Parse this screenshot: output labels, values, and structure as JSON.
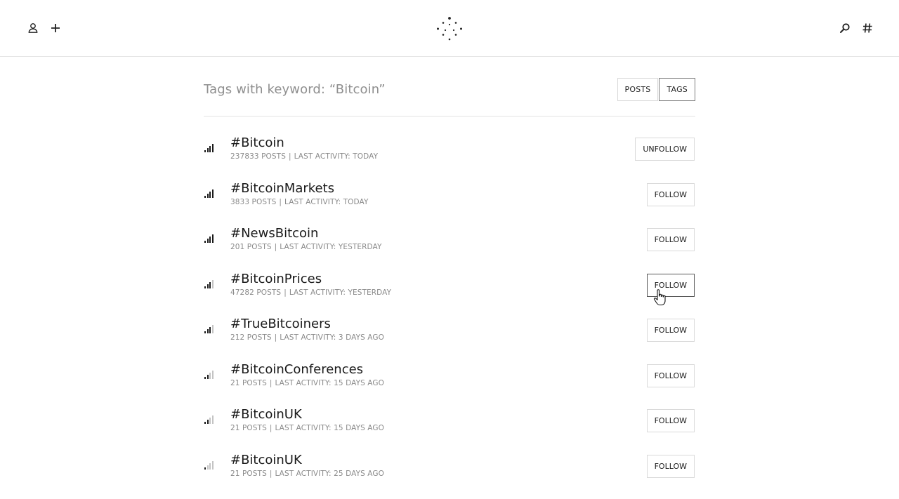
{
  "header": {
    "icons": {
      "profile": "user-icon",
      "add": "plus-icon",
      "logo": "dotted-circle-logo",
      "search": "search-icon",
      "tags": "hashtag-icon"
    }
  },
  "page": {
    "title": "Tags with keyword: “Bitcoin”",
    "toggle": {
      "posts_label": "POSTS",
      "tags_label": "TAGS",
      "active": "TAGS"
    }
  },
  "colors": {
    "signal_strong": "#1a1a1a",
    "signal_weak": "#c4c4c4",
    "border": "#d9d9d9",
    "muted_text": "#8a8a8a"
  },
  "tags": [
    {
      "name": "#Bitcoin",
      "posts": "237833 POSTS",
      "activity": "LAST ACTIVITY: TODAY",
      "button": "UNFOLLOW",
      "signal": 4
    },
    {
      "name": "#BitcoinMarkets",
      "posts": "3833 POSTS",
      "activity": "LAST ACTIVITY: TODAY",
      "button": "FOLLOW",
      "signal": 4
    },
    {
      "name": "#NewsBitcoin",
      "posts": "201 POSTS",
      "activity": "LAST ACTIVITY: YESTERDAY",
      "button": "FOLLOW",
      "signal": 4
    },
    {
      "name": "#BitcoinPrices",
      "posts": "47282 POSTS",
      "activity": "LAST ACTIVITY: YESTERDAY",
      "button": "FOLLOW",
      "signal": 3
    },
    {
      "name": "#TrueBitcoiners",
      "posts": "212 POSTS",
      "activity": "LAST ACTIVITY: 3 DAYS AGO",
      "button": "FOLLOW",
      "signal": 3
    },
    {
      "name": "#BitcoinConferences",
      "posts": "21 POSTS",
      "activity": "LAST ACTIVITY: 15 DAYS AGO",
      "button": "FOLLOW",
      "signal": 2
    },
    {
      "name": "#BitcoinUK",
      "posts": "21 POSTS",
      "activity": "LAST ACTIVITY: 15 DAYS AGO",
      "button": "FOLLOW",
      "signal": 2
    },
    {
      "name": "#BitcoinUK",
      "posts": "21 POSTS",
      "activity": "LAST ACTIVITY: 25 DAYS AGO",
      "button": "FOLLOW",
      "signal": 1
    }
  ]
}
